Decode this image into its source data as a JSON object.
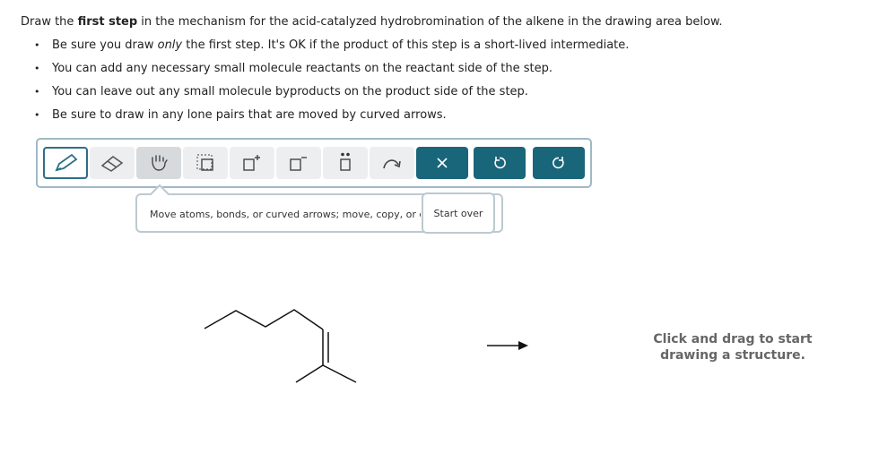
{
  "prompt": {
    "prefix": "Draw the ",
    "emphasis": "first step",
    "suffix": " in the mechanism for the acid-catalyzed hydrobromination of the alkene in the drawing area below."
  },
  "instructions": [
    {
      "pre": "Be sure you draw ",
      "em": "only",
      "post": " the first step. It's OK if the product of this step is a short-lived intermediate."
    },
    {
      "pre": "You can add any necessary small molecule reactants on the reactant side of the step.",
      "em": "",
      "post": ""
    },
    {
      "pre": "You can leave out any small molecule byproducts on the product side of the step.",
      "em": "",
      "post": ""
    },
    {
      "pre": "Be sure to draw in any lone pairs that are moved by curved arrows.",
      "em": "",
      "post": ""
    }
  ],
  "toolbar": {
    "tools": [
      {
        "name": "pencil-icon",
        "state": "selected"
      },
      {
        "name": "eraser-icon",
        "state": "normal"
      },
      {
        "name": "hand-move-icon",
        "state": "hovered"
      },
      {
        "name": "select-copy-icon",
        "state": "normal"
      },
      {
        "name": "positive-charge-icon",
        "state": "normal"
      },
      {
        "name": "negative-charge-icon",
        "state": "normal"
      },
      {
        "name": "lone-pair-icon",
        "state": "normal"
      },
      {
        "name": "curved-arrow-icon",
        "state": "normal"
      },
      {
        "name": "clear-icon",
        "state": "action"
      },
      {
        "name": "undo-icon",
        "state": "action"
      },
      {
        "name": "redo-icon",
        "state": "action"
      }
    ],
    "accent_color": "#19667a"
  },
  "tooltip": {
    "text": "Move atoms, bonds, or curved arrows; move, copy, or delete selected items."
  },
  "start_over": {
    "label": "Start over"
  },
  "canvas": {
    "hint_line1": "Click and drag to start",
    "hint_line2": "drawing a structure."
  }
}
